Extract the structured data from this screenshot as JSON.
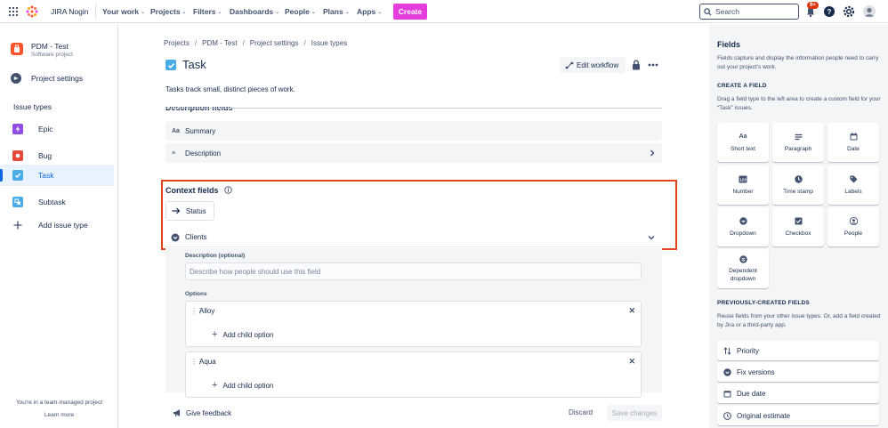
{
  "topnav": {
    "brand": "JIRA Nogin",
    "items": [
      "Your work",
      "Projects",
      "Filters",
      "Dashboards",
      "People",
      "Plans",
      "Apps"
    ],
    "create_label": "Create",
    "search_placeholder": "Search",
    "notification_badge": "9+",
    "colors": {
      "create": "#e53cdc",
      "badge": "#de350b"
    }
  },
  "sidebar": {
    "project_name": "PDM - Test",
    "project_type": "Software project",
    "project_settings": "Project settings",
    "section_label": "Issue types",
    "items": [
      {
        "label": "Epic",
        "icon": "epic-icon",
        "color": "#904ee2"
      },
      {
        "label": "Bug",
        "icon": "bug-icon",
        "color": "#e5493a"
      },
      {
        "label": "Task",
        "icon": "task-icon",
        "color": "#4bade8"
      },
      {
        "label": "Subtask",
        "icon": "subtask-icon",
        "color": "#4bade8"
      },
      {
        "label": "Add issue type",
        "icon": "plus-icon",
        "color": "#42526e"
      }
    ],
    "team_note": "You're in a team-managed project",
    "learn_more": "Learn more"
  },
  "main": {
    "breadcrumbs": [
      "Projects",
      "PDM - Test",
      "Project settings",
      "Issue types"
    ],
    "title": "Task",
    "edit_workflow": "Edit workflow",
    "description": "Tasks track small, distinct pieces of work.",
    "description_fields_heading": "Description fields",
    "description_fields": [
      {
        "icon": "Aa",
        "name": "Summary"
      },
      {
        "icon": "≡",
        "name": "Description"
      }
    ],
    "context_heading": "Context fields",
    "status_label": "Status",
    "clients_label": "Clients",
    "field_config": {
      "description_label": "Description (optional)",
      "description_placeholder": "Describe how people should use this field",
      "options_label": "Options",
      "options": [
        "Alloy",
        "Aqua"
      ],
      "add_child_option": "Add child option"
    },
    "give_feedback": "Give feedback",
    "discard": "Discard",
    "save_changes": "Save changes",
    "highlight_color": "#e2441b"
  },
  "right_panel": {
    "title": "Fields",
    "description": "Fields capture and display the information people need to carry out your project's work.",
    "create_heading": "CREATE A FIELD",
    "create_desc": "Drag a field type to the left area to create a custom field for your “Task” issues.",
    "field_types": [
      {
        "label": "Short text",
        "icon": "short-text-icon"
      },
      {
        "label": "Paragraph",
        "icon": "paragraph-icon"
      },
      {
        "label": "Date",
        "icon": "date-icon"
      },
      {
        "label": "Number",
        "icon": "number-icon"
      },
      {
        "label": "Time stamp",
        "icon": "clock-icon"
      },
      {
        "label": "Labels",
        "icon": "label-icon"
      },
      {
        "label": "Dropdown",
        "icon": "dropdown-icon"
      },
      {
        "label": "Checkbox",
        "icon": "checkbox-icon"
      },
      {
        "label": "People",
        "icon": "person-icon"
      },
      {
        "label": "Dependent dropdown",
        "icon": "dependent-dropdown-icon"
      }
    ],
    "prev_heading": "PREVIOUSLY-CREATED FIELDS",
    "prev_desc": "Reuse fields from your other issue types. Or, add a field created by Jira or a third-party app.",
    "prev_fields": [
      {
        "label": "Priority",
        "icon": "priority-icon"
      },
      {
        "label": "Fix versions",
        "icon": "fix-versions-icon"
      },
      {
        "label": "Due date",
        "icon": "calendar-icon"
      },
      {
        "label": "Original estimate",
        "icon": "clock-icon"
      }
    ]
  }
}
